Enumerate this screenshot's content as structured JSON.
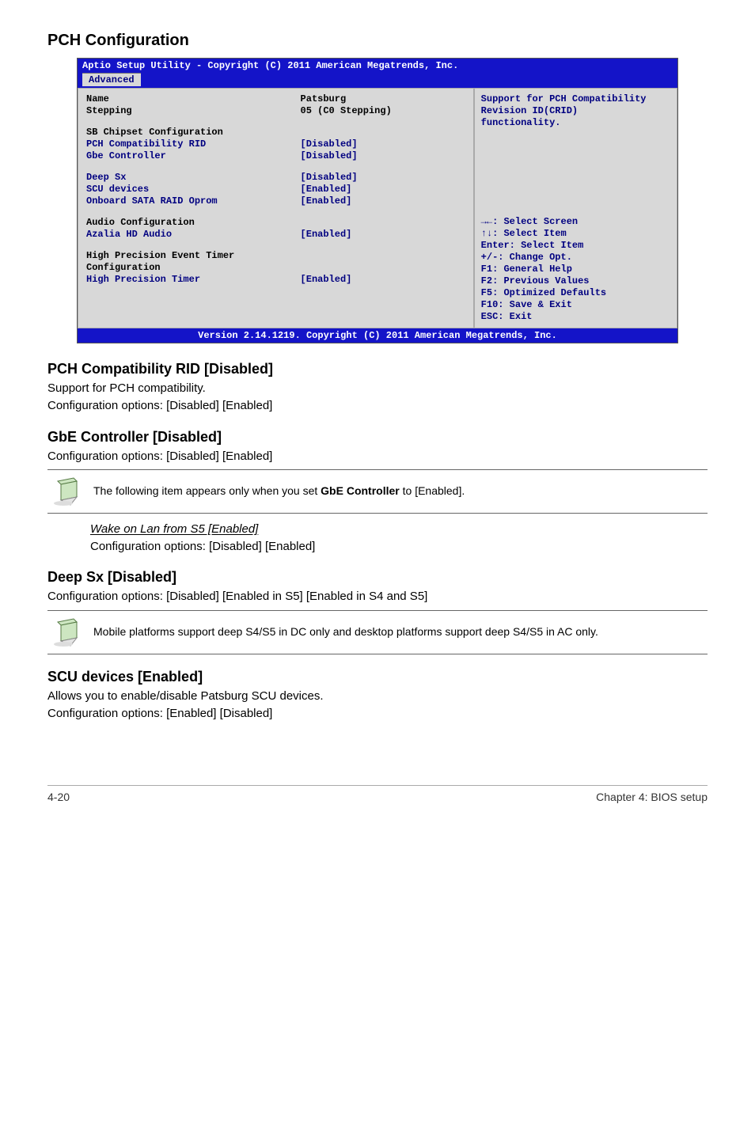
{
  "headings": {
    "pch_configuration": "PCH Configuration",
    "pch_compat_rid": "PCH Compatibility RID [Disabled]",
    "gbe_controller": "GbE Controller [Disabled]",
    "deep_sx": "Deep Sx [Disabled]",
    "scu_devices": "SCU devices [Enabled]"
  },
  "body": {
    "pch_compat_support": "Support for PCH compatibility.",
    "config_opts_de": "Configuration options: [Disabled] [Enabled]",
    "config_opts_ed": "Configuration options: [Enabled] [Disabled]",
    "deep_sx_opts": "Configuration options: [Disabled] [Enabled in S5] [Enabled in S4 and S5]",
    "gbe_note_pre": "The following item appears only when you set ",
    "gbe_note_bold": "GbE Controller",
    "gbe_note_post": " to [Enabled].",
    "wake_on_lan": "Wake on Lan from S5 [Enabled]",
    "deep_sx_note": "Mobile platforms support deep S4/S5 in DC only and desktop platforms support deep S4/S5 in AC only.",
    "scu_desc": "Allows you to enable/disable Patsburg SCU devices."
  },
  "bios": {
    "titlebar_text": "Aptio Setup Utility - Copyright (C) 2011 American Megatrends, Inc.",
    "tab": "Advanced",
    "rows": {
      "name_label": "Name",
      "name_value": "Patsburg",
      "stepping_label": "Stepping",
      "stepping_value": "05 (C0 Stepping)",
      "sb_chipset": "SB Chipset Configuration",
      "pch_compat_rid_label": "PCH Compatibility RID",
      "pch_compat_rid_value": "[Disabled]",
      "gbe_label": "Gbe Controller",
      "gbe_value": "[Disabled]",
      "deep_sx_label": "Deep Sx",
      "deep_sx_value": "[Disabled]",
      "scu_label": "SCU devices",
      "scu_value": "[Enabled]",
      "onboard_sata_label": "Onboard SATA RAID Oprom",
      "onboard_sata_value": "[Enabled]",
      "audio_conf": "Audio Configuration",
      "azalia_label": "Azalia HD Audio",
      "azalia_value": "[Enabled]",
      "hpet_conf": "High Precision Event Timer Configuration",
      "hpet_label": "High Precision Timer",
      "hpet_value": "[Enabled]"
    },
    "help_top": {
      "l1": "Support for PCH Compatibility",
      "l2": "Revision ID(CRID)",
      "l3": "functionality."
    },
    "help_keys": {
      "k1": "→←: Select Screen",
      "k2": "↑↓:  Select Item",
      "k3": "Enter: Select Item",
      "k4": "+/-: Change Opt.",
      "k5": "F1: General Help",
      "k6": "F2: Previous Values",
      "k7": "F5: Optimized Defaults",
      "k8": "F10: Save & Exit",
      "k9": "ESC: Exit"
    },
    "footer": "Version 2.14.1219. Copyright (C) 2011 American Megatrends, Inc."
  },
  "footer": {
    "page": "4-20",
    "chapter": "Chapter 4: BIOS setup"
  }
}
